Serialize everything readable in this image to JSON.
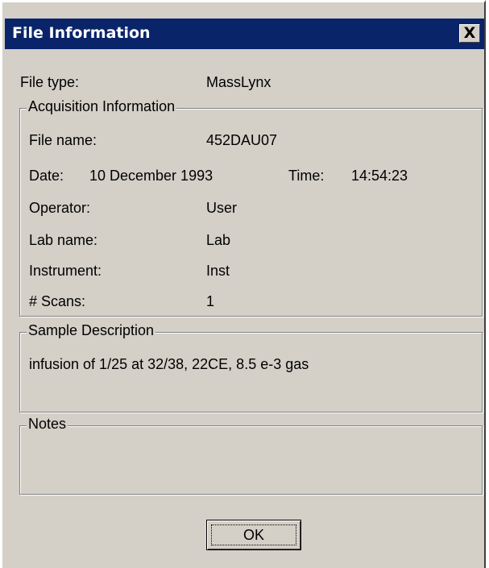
{
  "window": {
    "title": "File Information",
    "close_label": "X"
  },
  "file_type": {
    "label": "File type:",
    "value": "MassLynx"
  },
  "acquisition": {
    "legend": "Acquisition Information",
    "file_name_label": "File name:",
    "file_name_value": "452DAU07",
    "date_label": "Date:",
    "date_value": "10 December 1993",
    "time_label": "Time:",
    "time_value": "14:54:23",
    "operator_label": "Operator:",
    "operator_value": "User",
    "lab_label": "Lab name:",
    "lab_value": "Lab",
    "instrument_label": "Instrument:",
    "instrument_value": "Inst",
    "scans_label": "# Scans:",
    "scans_value": "1"
  },
  "sample": {
    "legend": "Sample Description",
    "text": "infusion of 1/25 at 32/38, 22CE, 8.5 e-3 gas"
  },
  "notes": {
    "legend": "Notes",
    "text": ""
  },
  "buttons": {
    "ok_label": "OK"
  },
  "colors": {
    "titlebar": "#0a246a",
    "face": "#d4d0c8"
  }
}
